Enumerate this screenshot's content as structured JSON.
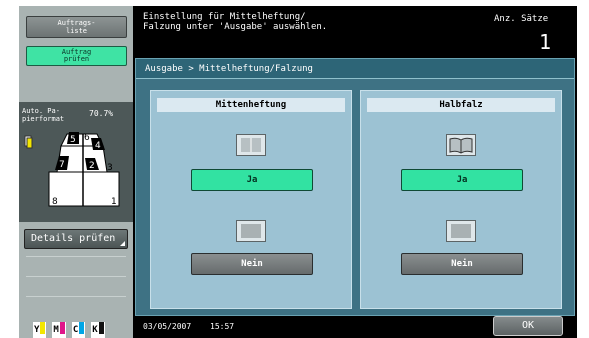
{
  "left_panel": {
    "job_list_label": "Auftrags-\nliste",
    "check_job_label": "Auftrag\nprüfen",
    "preview_label": "Auto. Pa-\npierformat",
    "preview_zoom": "70.7%",
    "pages": [
      "5",
      "6",
      "4",
      "7",
      "2",
      "3",
      "8",
      "1"
    ],
    "details_label": "Details prüfen",
    "toner": [
      {
        "letter": "Y",
        "color": "#f2e600"
      },
      {
        "letter": "M",
        "color": "#e0168a"
      },
      {
        "letter": "C",
        "color": "#00a6e6"
      },
      {
        "letter": "K",
        "color": "#111111"
      }
    ]
  },
  "header": {
    "message_line1": "Einstellung für Mittelheftung/",
    "message_line2": "Falzung unter 'Ausgabe' auswählen.",
    "sets_label": "Anz. Sätze",
    "sets_value": "1"
  },
  "main": {
    "breadcrumb": "Ausgabe > Mittelheftung/Falzung",
    "columns": [
      {
        "title": "Mittenheftung",
        "yes": "Ja",
        "no": "Nein"
      },
      {
        "title": "Halbfalz",
        "yes": "Ja",
        "no": "Nein"
      }
    ]
  },
  "footer": {
    "date": "03/05/2007",
    "time": "15:57",
    "ok_label": "OK"
  },
  "colors": {
    "accent_green": "#32e2a2",
    "panel_blue": "#3e7284",
    "column_blue": "#9cc2d3"
  }
}
